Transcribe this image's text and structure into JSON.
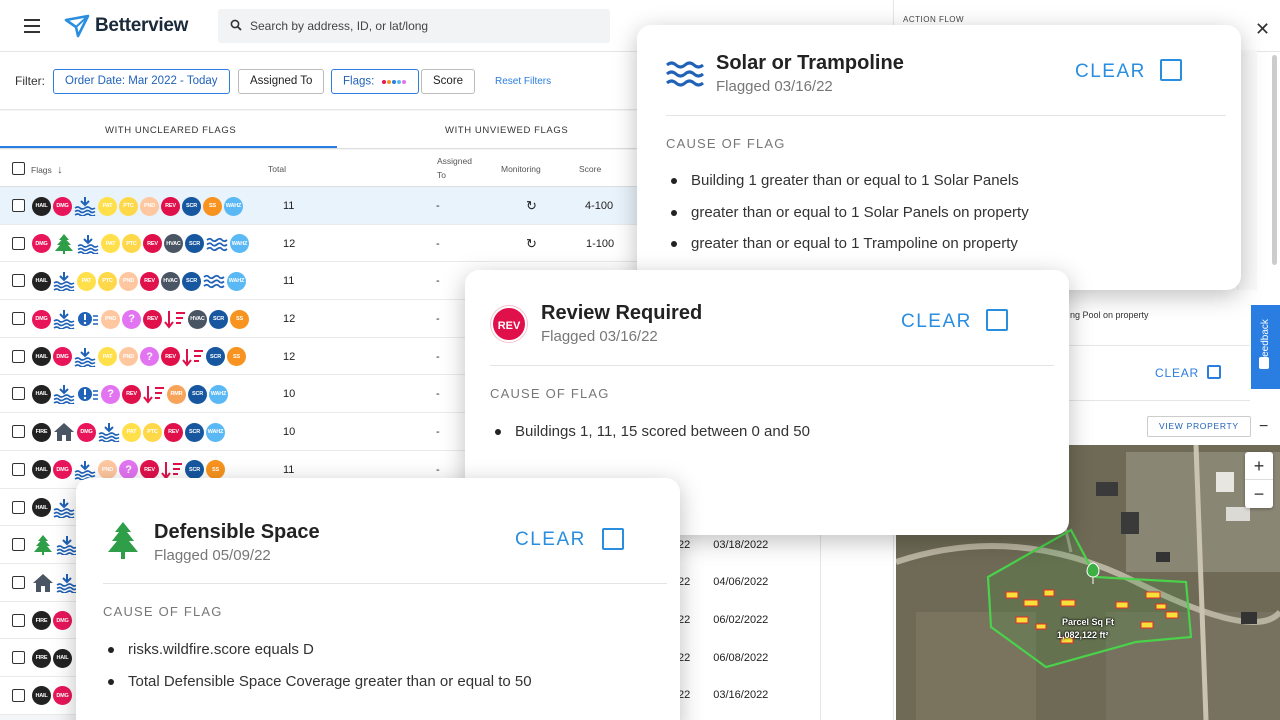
{
  "header": {
    "logo_text": "Betterview",
    "search_placeholder": "Search by address, ID, or lat/long"
  },
  "filters": {
    "label": "Filter:",
    "order_date": "Order Date: Mar 2022 - Today",
    "assigned_to": "Assigned To",
    "flags": "Flags:",
    "score": "Score",
    "reset": "Reset Filters",
    "flag_dot_colors": [
      "#e8155a",
      "#f7931e",
      "#2a7de1",
      "#5ab9f5",
      "#e274f2"
    ]
  },
  "tabs": {
    "uncleared": "WITH UNCLEARED FLAGS",
    "unviewed": "WITH UNVIEWED FLAGS"
  },
  "table": {
    "columns": {
      "flags": "Flags",
      "total": "Total",
      "assigned_to_1": "Assigned",
      "assigned_to_2": "To",
      "monitoring": "Monitoring",
      "score": "Score"
    },
    "rows": [
      {
        "total": "11",
        "assigned": "-",
        "monitoring": "↻",
        "score": "4-100"
      },
      {
        "total": "12",
        "assigned": "-",
        "monitoring": "↻",
        "score": "1-100"
      },
      {
        "total": "11",
        "assigned": "-"
      },
      {
        "total": "12",
        "assigned": "-"
      },
      {
        "total": "12",
        "assigned": "-"
      },
      {
        "total": "10",
        "assigned": "-"
      },
      {
        "total": "10",
        "assigned": "-"
      },
      {
        "total": "11",
        "assigned": "-"
      },
      {
        "total": "",
        "assigned": ""
      },
      {
        "total": "",
        "assigned": ""
      },
      {
        "total": "",
        "assigned": ""
      },
      {
        "total": "",
        "assigned": ""
      },
      {
        "total": "",
        "assigned": ""
      },
      {
        "total": "",
        "assigned": ""
      }
    ],
    "date_rows": [
      {
        "code": "22",
        "date": "03/18/2022"
      },
      {
        "code": "22",
        "date": "04/06/2022"
      },
      {
        "code": "22",
        "date": "06/02/2022"
      },
      {
        "code": "22",
        "date": "06/08/2022"
      },
      {
        "code": "22",
        "date": "03/16/2022"
      }
    ]
  },
  "flag_labels": {
    "hail": "HAIL",
    "dmg": "DMG",
    "fire": "FIRE",
    "pat": "PAT",
    "ptc": "PTC",
    "pnd": "PND",
    "rev": "REV",
    "scr": "SCR",
    "ss": "SS",
    "wahz": "WAHZ",
    "hvac": "HVAC",
    "rmr": "RMR",
    "q": "?"
  },
  "right_panel": {
    "action_flow": "ACTION FLOW",
    "pool_text": "ng Pool on property",
    "clear": "CLEAR",
    "feedback": "Feedback",
    "view_property": "VIEW PROPERTY",
    "parcel_label_1": "Parcel Sq Ft",
    "parcel_label_2": "1,082,122 ft²",
    "zoom_in": "+",
    "zoom_out": "−"
  },
  "cards": {
    "solar": {
      "title": "Solar or Trampoline",
      "flagged": "Flagged 03/16/22",
      "clear": "CLEAR",
      "cause_label": "CAUSE OF FLAG",
      "causes": [
        "Building 1 greater than or equal to 1 Solar Panels",
        "greater than or equal to 1 Solar Panels on property",
        "greater than or equal to 1 Trampoline on property"
      ]
    },
    "review": {
      "badge": "REV",
      "title": "Review Required",
      "flagged": "Flagged 03/16/22",
      "clear": "CLEAR",
      "cause_label": "CAUSE OF FLAG",
      "causes": [
        "Buildings 1, 11, 15 scored between 0 and 50"
      ]
    },
    "defensible": {
      "title": "Defensible Space",
      "flagged": "Flagged 05/09/22",
      "clear": "CLEAR",
      "cause_label": "CAUSE OF FLAG",
      "causes": [
        "risks.wildfire.score equals D",
        "Total Defensible Space Coverage greater than or equal to 50"
      ]
    }
  },
  "colors": {
    "accent": "#2a7de1",
    "card_clear": "#2a8ee0",
    "rev": "#e0104b",
    "tree": "#2e9e48"
  }
}
